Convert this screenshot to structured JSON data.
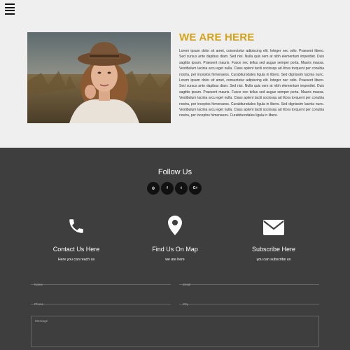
{
  "nav": {
    "menu_icon": "hamburger-icon"
  },
  "about": {
    "title": "WE ARE HERE",
    "photo_description": "portrait photo of a woman in a hat in a field",
    "body": "Lorem ipsum dolor sit amet, consectetur adipiscing elit. Integer nec odio. Praesent libero. Sed cursus ante dapibus diam. Sed nisi. Nulla quis sem at nibh elementum imperdiet. Duis sagittis ipsum. Praesent mauris. Fusce nec tellus sed augue semper porta. Mauris massa. Vestibulum lacinia arcu eget nulla. Class aptent taciti sociosqu ad litora torquent per conubia nostra, per inceptos himenaeos. Curabiturodales ligula in libero. Sed dignissim lacinia nunc. Lorem ipsum dolor sit amet, consectetur adipiscing elit. Integer nec odio. Praesent libero. Sed cursus ante dapibus diam. Sed nisi. Nulla quis sem at nibh elementum imperdiet. Duis sagittis ipsum. Praesent mauris. Fusce nec tellus sed augue semper porta. Mauris massa. Vestibulum lacinia arcu eget nulla. Class aptent taciti sociosqu ad litora torquent per conubia nostra, per inceptos himenaeos. Curabiturodales ligula in libero. Sed dignissim lacinia nunc. Vestibulum lacinia arcu eget nulla. Class aptent taciti sociosqu ad litora torquent per conubia nostra, per inceptos himenaeos. Curabiturodales ligula in libero."
  },
  "follow": {
    "title": "Follow Us",
    "socials": [
      {
        "icon": "instagram-icon",
        "glyph": "◎"
      },
      {
        "icon": "facebook-icon",
        "glyph": "f"
      },
      {
        "icon": "twitter-icon",
        "glyph": "t"
      },
      {
        "icon": "google-plus-icon",
        "glyph": "G+"
      }
    ]
  },
  "contact_columns": [
    {
      "icon": "phone-icon",
      "title": "Contact Us Here",
      "sub": "Here you can reach us"
    },
    {
      "icon": "map-pin-icon",
      "title": "Find Us On Map",
      "sub": "we are here"
    },
    {
      "icon": "mail-icon",
      "title": "Subscribe Here",
      "sub": "you can subscribe us"
    }
  ],
  "form": {
    "name_placeholder": "Name",
    "email_placeholder": "Email",
    "phone_placeholder": "Phone",
    "city_placeholder": "City",
    "message_placeholder": "Message"
  }
}
